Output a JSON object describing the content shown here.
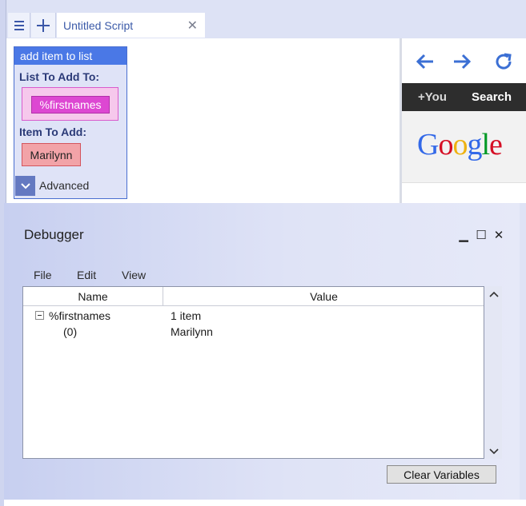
{
  "tabs": {
    "menu_icon": "hamburger-icon",
    "add_icon": "plus-icon",
    "active_title": "Untitled Script",
    "close_glyph": "✕"
  },
  "block": {
    "title": "add item to list",
    "list_label": "List To Add To:",
    "list_value": "%firstnames",
    "item_label": "Item To Add:",
    "item_value": "Marilynn",
    "advanced_label": "Advanced"
  },
  "browser": {
    "back_icon": "arrow-left-icon",
    "forward_icon": "arrow-right-icon",
    "reload_icon": "reload-icon",
    "bar_you": "+You",
    "bar_search": "Search",
    "logo_letters": [
      "G",
      "o",
      "o",
      "g",
      "l",
      "e"
    ],
    "logo_colors": [
      "#3369e8",
      "#d50f25",
      "#eeb211",
      "#3369e8",
      "#009925",
      "#d50f25"
    ]
  },
  "debugger": {
    "title": "Debugger",
    "window_buttons": {
      "minimize": "▁",
      "maximize": "☐",
      "close": "✕"
    },
    "menu": [
      "File",
      "Edit",
      "View"
    ],
    "columns": {
      "name": "Name",
      "value": "Value"
    },
    "rows": [
      {
        "name": "%firstnames",
        "value": "1 item",
        "expandable": true,
        "expanded": true
      },
      {
        "name": "(0)",
        "value": "Marilynn",
        "expandable": false
      }
    ],
    "clear_button": "Clear Variables"
  },
  "colors": {
    "accent": "#4a78e6",
    "list_chip": "#dd47d2",
    "item_chip": "#f2a3a8",
    "tab_text": "#3b5aa8"
  }
}
